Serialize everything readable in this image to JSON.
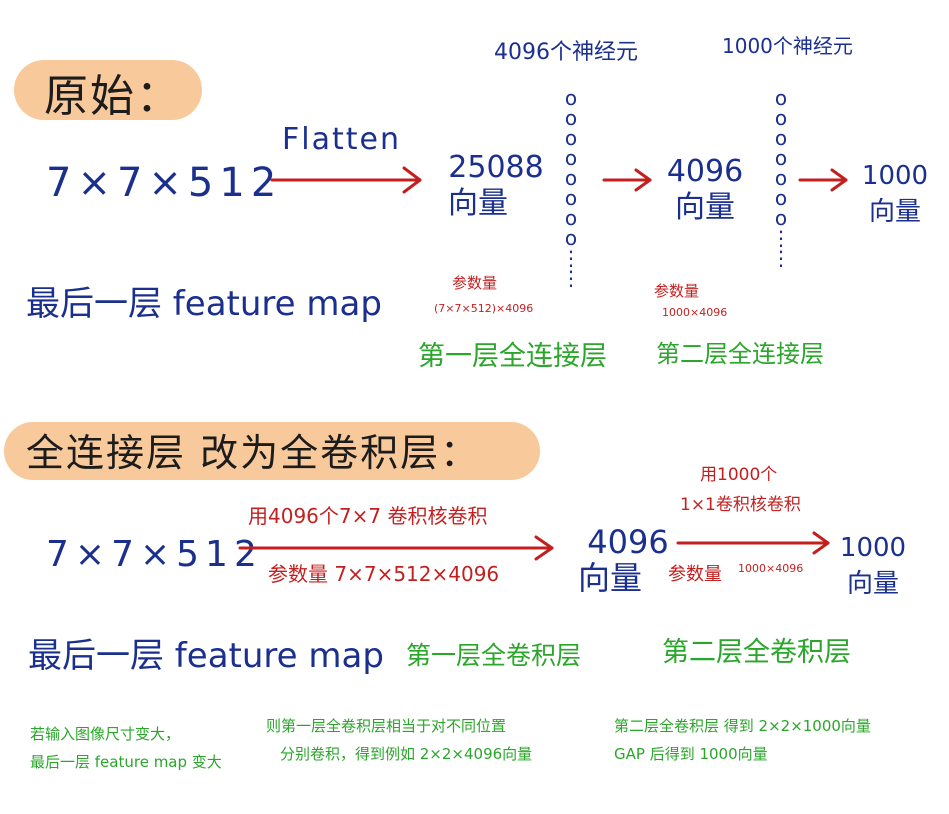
{
  "section1": {
    "heading": "原始：",
    "input_dims": "7×7×512",
    "flatten_label": "Flatten",
    "input_desc": "最后一层 feature map",
    "vec1": {
      "value": "25088",
      "unit": "向量"
    },
    "neurons1": "4096个神经元",
    "neurons2": "1000个神经元",
    "vec2": {
      "value": "4096",
      "unit": "向量"
    },
    "vec3": {
      "value": "1000",
      "unit": "向量"
    },
    "params1_title": "参数量",
    "params1_formula": "(7×7×512)×4096",
    "params2_title": "参数量",
    "params2_formula": "1000×4096",
    "layer1_label": "第一层全连接层",
    "layer2_label": "第二层全连接层"
  },
  "section2": {
    "heading": "全连接层 改为全卷积层：",
    "input_dims": "7×7×512",
    "conv1_label": "用4096个7×7 卷积核卷积",
    "params1": "参数量 7×7×512×4096",
    "vec1": {
      "value": "4096",
      "unit": "向量"
    },
    "conv2_label_line1": "用1000个",
    "conv2_label_line2": "1×1卷积核卷积",
    "params2_title": "参数量",
    "params2_formula": "1000×4096",
    "vec2": {
      "value": "1000",
      "unit": "向量"
    },
    "input_desc": "最后一层 feature map",
    "layer1_label": "第一层全卷积层",
    "layer2_label": "第二层全卷积层"
  },
  "notes": {
    "note1_line1": "若输入图像尺寸变大，",
    "note1_line2": "最后一层 feature map 变大",
    "note2_line1": "则第一层全卷积层相当于对不同位置",
    "note2_line2": "分别卷积，得到例如 2×2×4096向量",
    "note3_line1": "第二层全卷积层 得到 2×2×1000向量",
    "note3_line2": "GAP 后得到 1000向量"
  },
  "colors": {
    "blue": "#1b2f8f",
    "red": "#c41f1f",
    "green": "#2aa62a",
    "highlight": "#f8c99a"
  }
}
